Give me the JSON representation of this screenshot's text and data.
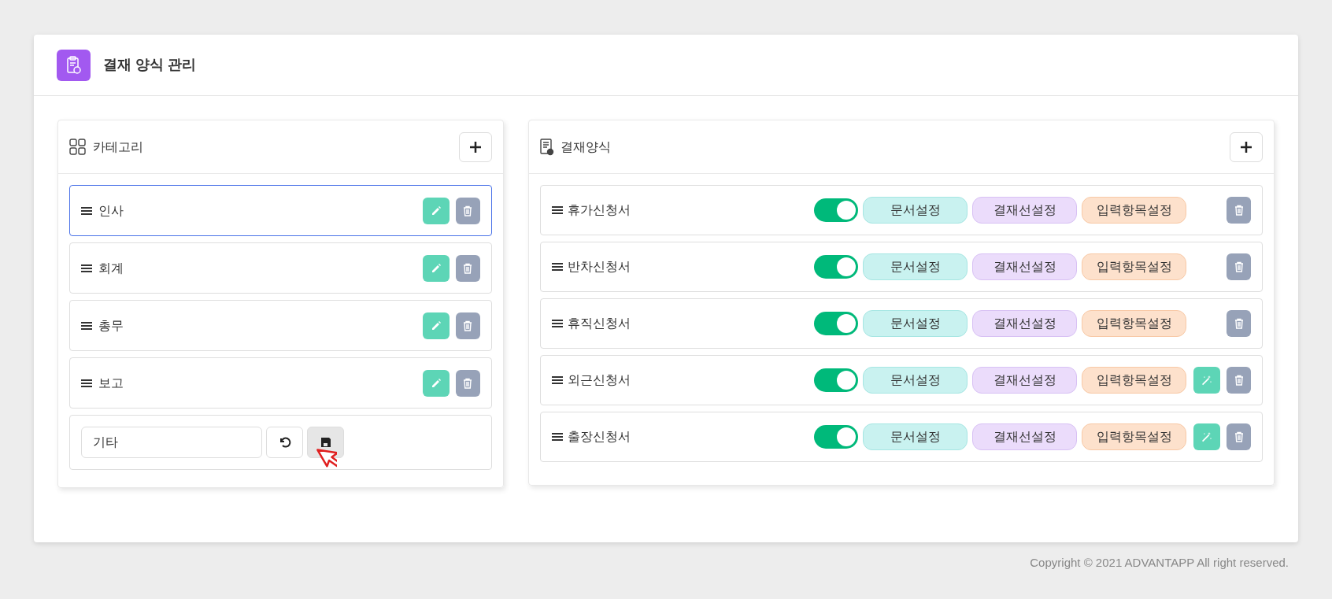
{
  "page": {
    "title": "결재 양식 관리"
  },
  "categories": {
    "title": "카테고리",
    "items": [
      {
        "kind": "item",
        "label": "인사",
        "selected": true
      },
      {
        "kind": "item",
        "label": "회계",
        "selected": false
      },
      {
        "kind": "item",
        "label": "총무",
        "selected": false
      },
      {
        "kind": "item",
        "label": "보고",
        "selected": false
      },
      {
        "kind": "editing",
        "value": "기타",
        "selected": false
      }
    ]
  },
  "forms": {
    "title": "결재양식",
    "rows": [
      {
        "label": "휴가신청서",
        "on": true,
        "buttons": [
          "문서설정",
          "결재선설정",
          "입력항목설정"
        ],
        "wand": false
      },
      {
        "label": "반차신청서",
        "on": true,
        "buttons": [
          "문서설정",
          "결재선설정",
          "입력항목설정"
        ],
        "wand": false
      },
      {
        "label": "휴직신청서",
        "on": true,
        "buttons": [
          "문서설정",
          "결재선설정",
          "입력항목설정"
        ],
        "wand": false
      },
      {
        "label": "외근신청서",
        "on": true,
        "buttons": [
          "문서설정",
          "결재선설정",
          "입력항목설정"
        ],
        "wand": true
      },
      {
        "label": "출장신청서",
        "on": true,
        "buttons": [
          "문서설정",
          "결재선설정",
          "입력항목설정"
        ],
        "wand": true
      }
    ]
  },
  "footer": "Copyright © 2021 ADVANTAPP All right reserved."
}
